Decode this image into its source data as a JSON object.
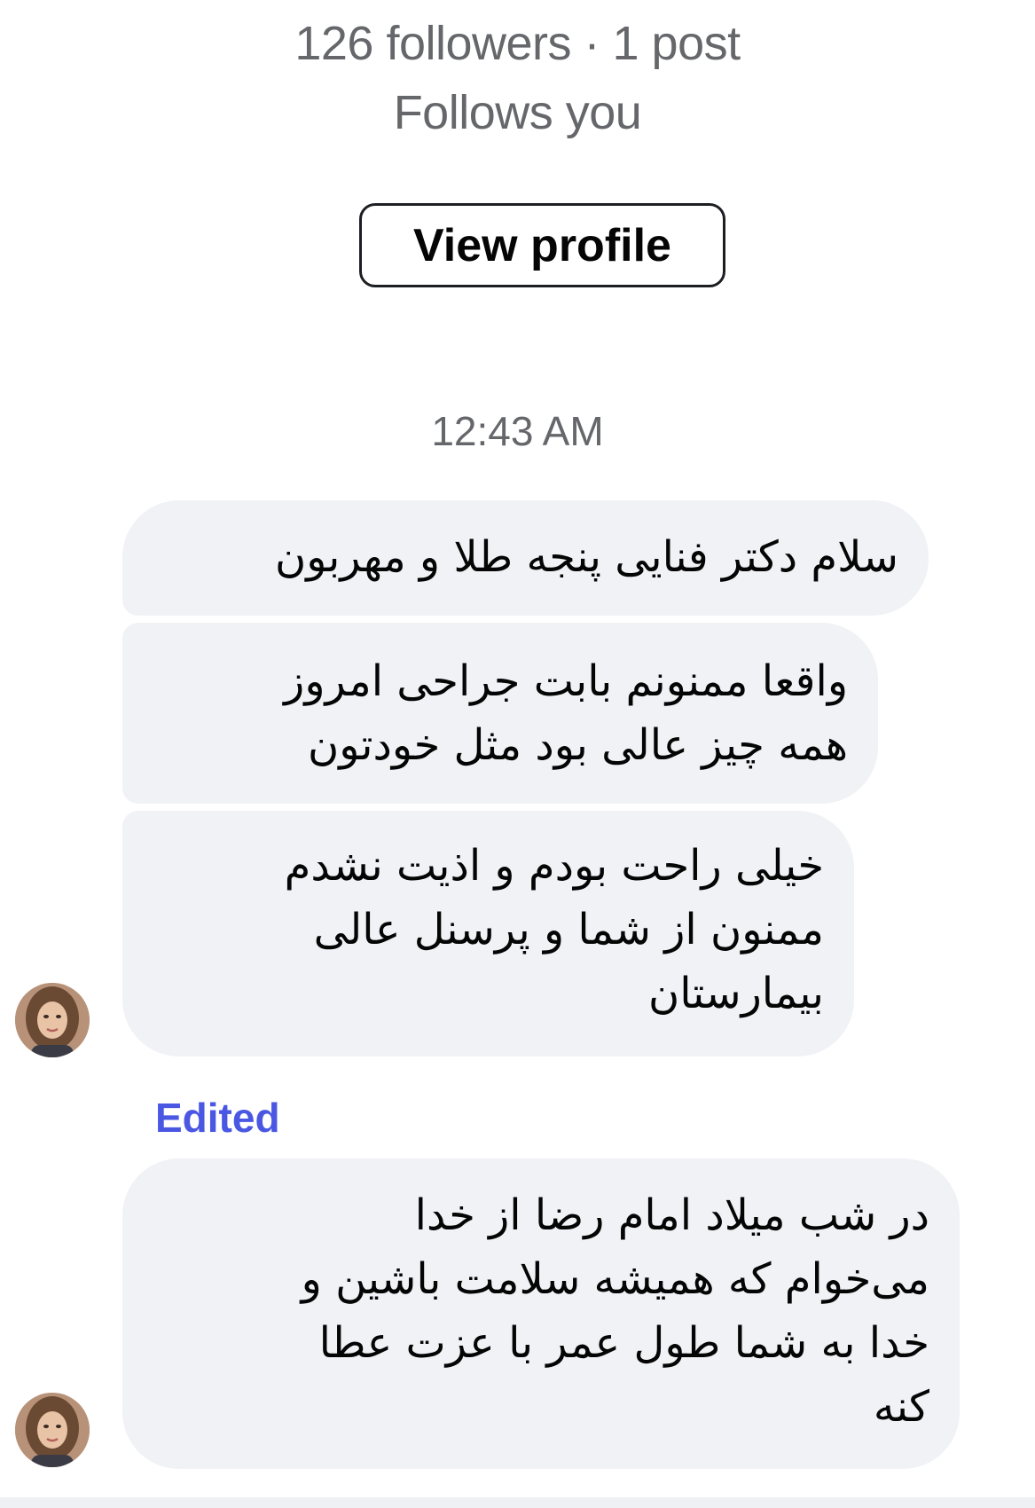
{
  "profile": {
    "stats": "126 followers · 1 post",
    "follows_you": "Follows you",
    "view_profile_label": "View profile"
  },
  "thread": {
    "timestamp": "12:43 AM",
    "messages": [
      "سلام دکتر فنایی پنجه طلا و مهربون",
      "واقعا ممنونم بابت جراحی امروز\nهمه چیز عالی بود مثل خودتون",
      "خیلی راحت بودم و اذیت نشدم\nممنون از شما و پرسنل عالی\nبیمارستان"
    ],
    "edited_label": "Edited",
    "edited_message": "در شب میلاد امام رضا از خدا\nمی‌خوام که همیشه سلامت باشین و\nخدا به شما طول عمر با عزت عطا\nکنه"
  },
  "colors": {
    "bubble_bg": "#f0f2f5",
    "muted_text": "#65676b",
    "edited_accent": "#4a57e3"
  },
  "icons": {
    "avatar": "user-avatar-photo"
  }
}
